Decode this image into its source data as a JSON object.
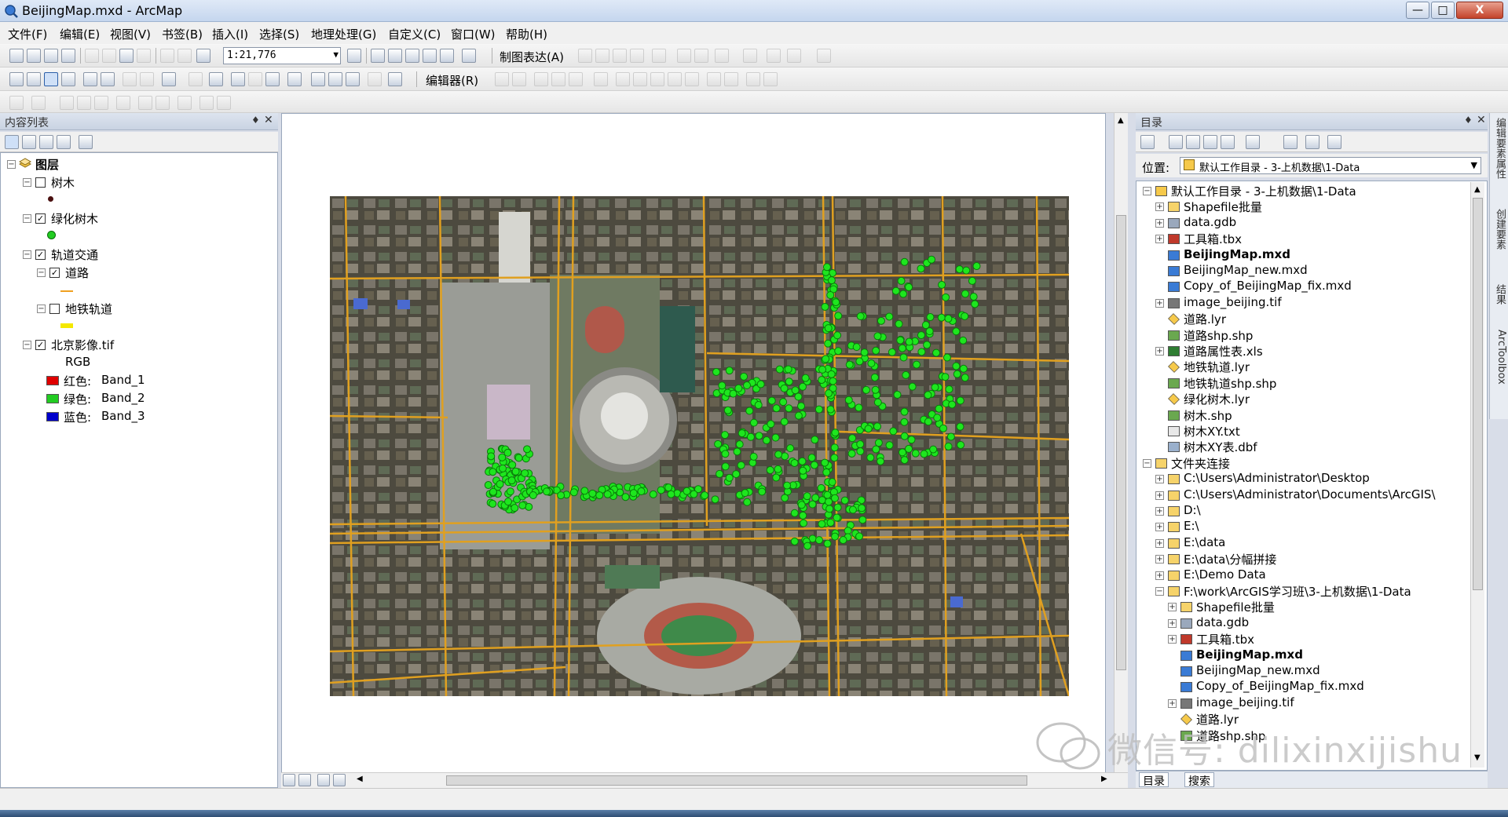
{
  "window": {
    "title": "BeijingMap.mxd - ArcMap",
    "min_label": "—",
    "max_label": "□",
    "close_label": "X"
  },
  "menubar": {
    "items": [
      "文件(F)",
      "编辑(E)",
      "视图(V)",
      "书签(B)",
      "插入(I)",
      "选择(S)",
      "地理处理(G)",
      "自定义(C)",
      "窗口(W)",
      "帮助(H)"
    ]
  },
  "toolbar": {
    "scale": "1:21,776",
    "cartographic_label": "制图表达(A)",
    "editor_label": "编辑器(R)"
  },
  "toc": {
    "title": "内容列表",
    "root": "图层",
    "layers": [
      {
        "name": "树木",
        "checked": false
      },
      {
        "name": "绿化树木",
        "checked": true
      },
      {
        "name": "轨道交通",
        "checked": true
      },
      {
        "name": "道路",
        "checked": true
      },
      {
        "name": "地铁轨道",
        "checked": false
      },
      {
        "name": "北京影像.tif",
        "checked": true
      }
    ],
    "rgb_label": "RGB",
    "bands": [
      {
        "channel": "红色:",
        "band": "Band_1",
        "color": "#e00000"
      },
      {
        "channel": "绿色:",
        "band": "Band_2",
        "color": "#22cc22"
      },
      {
        "channel": "蓝色:",
        "band": "Band_3",
        "color": "#0000cc"
      }
    ]
  },
  "catalog": {
    "title": "目录",
    "location_label": "位置:",
    "location_value": "默认工作目录 - 3-上机数据\\1-Data",
    "items": [
      {
        "label": "默认工作目录 - 3-上机数据\\1-Data",
        "type": "home",
        "bold": false
      },
      {
        "label": "Shapefile批量",
        "type": "folder",
        "bold": false
      },
      {
        "label": "data.gdb",
        "type": "gdb",
        "bold": false
      },
      {
        "label": "工具箱.tbx",
        "type": "tbx",
        "bold": false
      },
      {
        "label": "BeijingMap.mxd",
        "type": "mxd",
        "bold": true
      },
      {
        "label": "BeijingMap_new.mxd",
        "type": "mxd",
        "bold": false
      },
      {
        "label": "Copy_of_BeijingMap_fix.mxd",
        "type": "mxd",
        "bold": false
      },
      {
        "label": "image_beijing.tif",
        "type": "raster",
        "bold": false
      },
      {
        "label": "道路.lyr",
        "type": "lyr",
        "bold": false
      },
      {
        "label": "道路shp.shp",
        "type": "shp",
        "bold": false
      },
      {
        "label": "道路属性表.xls",
        "type": "xls",
        "bold": false
      },
      {
        "label": "地铁轨道.lyr",
        "type": "lyr",
        "bold": false
      },
      {
        "label": "地铁轨道shp.shp",
        "type": "shp",
        "bold": false
      },
      {
        "label": "绿化树木.lyr",
        "type": "lyr",
        "bold": false
      },
      {
        "label": "树木.shp",
        "type": "shp",
        "bold": false
      },
      {
        "label": "树木XY.txt",
        "type": "txt",
        "bold": false
      },
      {
        "label": "树木XY表.dbf",
        "type": "dbf",
        "bold": false
      },
      {
        "label": "文件夹连接",
        "type": "folder",
        "bold": false
      },
      {
        "label": "C:\\Users\\Administrator\\Desktop",
        "type": "folder",
        "bold": false
      },
      {
        "label": "C:\\Users\\Administrator\\Documents\\ArcGIS\\",
        "type": "folder",
        "bold": false
      },
      {
        "label": "D:\\",
        "type": "folder",
        "bold": false
      },
      {
        "label": "E:\\",
        "type": "folder",
        "bold": false
      },
      {
        "label": "E:\\data",
        "type": "folder",
        "bold": false
      },
      {
        "label": "E:\\data\\分幅拼接",
        "type": "folder",
        "bold": false
      },
      {
        "label": "E:\\Demo Data",
        "type": "folder",
        "bold": false
      },
      {
        "label": "F:\\work\\ArcGIS学习班\\3-上机数据\\1-Data",
        "type": "folder",
        "bold": false
      },
      {
        "label": "Shapefile批量",
        "type": "folder",
        "bold": false
      },
      {
        "label": "data.gdb",
        "type": "gdb",
        "bold": false
      },
      {
        "label": "工具箱.tbx",
        "type": "tbx",
        "bold": false
      },
      {
        "label": "BeijingMap.mxd",
        "type": "mxd",
        "bold": true
      },
      {
        "label": "BeijingMap_new.mxd",
        "type": "mxd",
        "bold": false
      },
      {
        "label": "Copy_of_BeijingMap_fix.mxd",
        "type": "mxd",
        "bold": false
      },
      {
        "label": "image_beijing.tif",
        "type": "raster",
        "bold": false
      },
      {
        "label": "道路.lyr",
        "type": "lyr",
        "bold": false
      },
      {
        "label": "道路shp.shp",
        "type": "shp",
        "bold": false
      }
    ],
    "tabs": [
      "目录",
      "搜索"
    ]
  },
  "right_dock": {
    "tabs": [
      "编辑要素属性",
      "创建要素",
      "结果",
      "ArcToolbox"
    ]
  },
  "watermark": "微信号: dilixinxijishu"
}
